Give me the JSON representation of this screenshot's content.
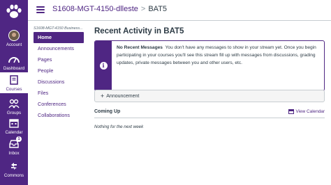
{
  "global_nav": {
    "items": [
      {
        "label": "Account",
        "icon": "avatar"
      },
      {
        "label": "Dashboard",
        "icon": "dashboard-icon"
      },
      {
        "label": "Courses",
        "icon": "courses-icon",
        "active": true
      },
      {
        "label": "Groups",
        "icon": "groups-icon"
      },
      {
        "label": "Calendar",
        "icon": "calendar-icon"
      },
      {
        "label": "Inbox",
        "icon": "inbox-icon",
        "badge": "1"
      },
      {
        "label": "Commons",
        "icon": "commons-icon"
      }
    ]
  },
  "header": {
    "course_link": "S1608-MGT-4150-dlleste",
    "separator": ">",
    "current": "BAT5"
  },
  "course_nav": {
    "title": "S1608-MGT-4150 Business...",
    "items": [
      {
        "label": "Home",
        "active": true
      },
      {
        "label": "Announcements"
      },
      {
        "label": "Pages"
      },
      {
        "label": "People"
      },
      {
        "label": "Discussions"
      },
      {
        "label": "Files"
      },
      {
        "label": "Conferences"
      },
      {
        "label": "Collaborations"
      }
    ]
  },
  "main": {
    "title": "Recent Activity in BAT5",
    "alert": {
      "heading": "No Recent Messages",
      "body": "You don't have any messages to show in your stream yet. Once you begin participating in your courses you'll see this stream fill up with messages from discussions, grading updates, private messages between you and other users, etc."
    },
    "announcement_button": "Announcement",
    "coming_up": {
      "title": "Coming Up",
      "view_calendar": "View Calendar",
      "empty": "Nothing for the next week"
    }
  },
  "colors": {
    "brand": "#4f2683",
    "text": "#2d3b45",
    "border": "#c7cdd1"
  }
}
